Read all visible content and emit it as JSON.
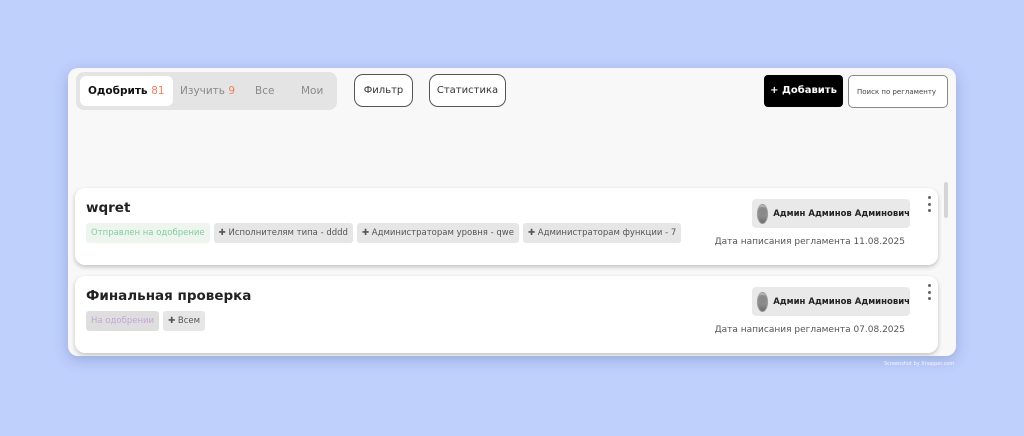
{
  "tabs": [
    {
      "label": "Одобрить",
      "count": "81"
    },
    {
      "label": "Изучить",
      "count": "9"
    },
    {
      "label": "Все",
      "count": ""
    },
    {
      "label": "Мои",
      "count": ""
    }
  ],
  "toolbar": {
    "filter_label": "Фильтр",
    "stats_label": "Статистика",
    "add_label": "+ Добавить",
    "search_placeholder": "Поиск по регламенту"
  },
  "cards": [
    {
      "title": "wqret",
      "status": "Отправлен на одобрение",
      "tags": [
        "✚ Исполнителям типа - dddd",
        "✚ Администраторам уровня - qwe",
        "✚ Администраторам функции - 7"
      ],
      "author": "Админ Админов Админович",
      "date": "Дата написания регламента 11.08.2025"
    },
    {
      "title": "Финальная проверка",
      "status": "На одобрении",
      "tags": [
        "✚ Всем"
      ],
      "author": "Админ Админов Админович",
      "date": "Дата написания регламента 07.08.2025"
    }
  ],
  "colors": {
    "background": "#bfd0fd",
    "accent_count": "#f07f63",
    "status_green": "#80cf9b",
    "status_purple": "#c3a5d6"
  },
  "watermark": "Screenshot by Xnapper.com"
}
